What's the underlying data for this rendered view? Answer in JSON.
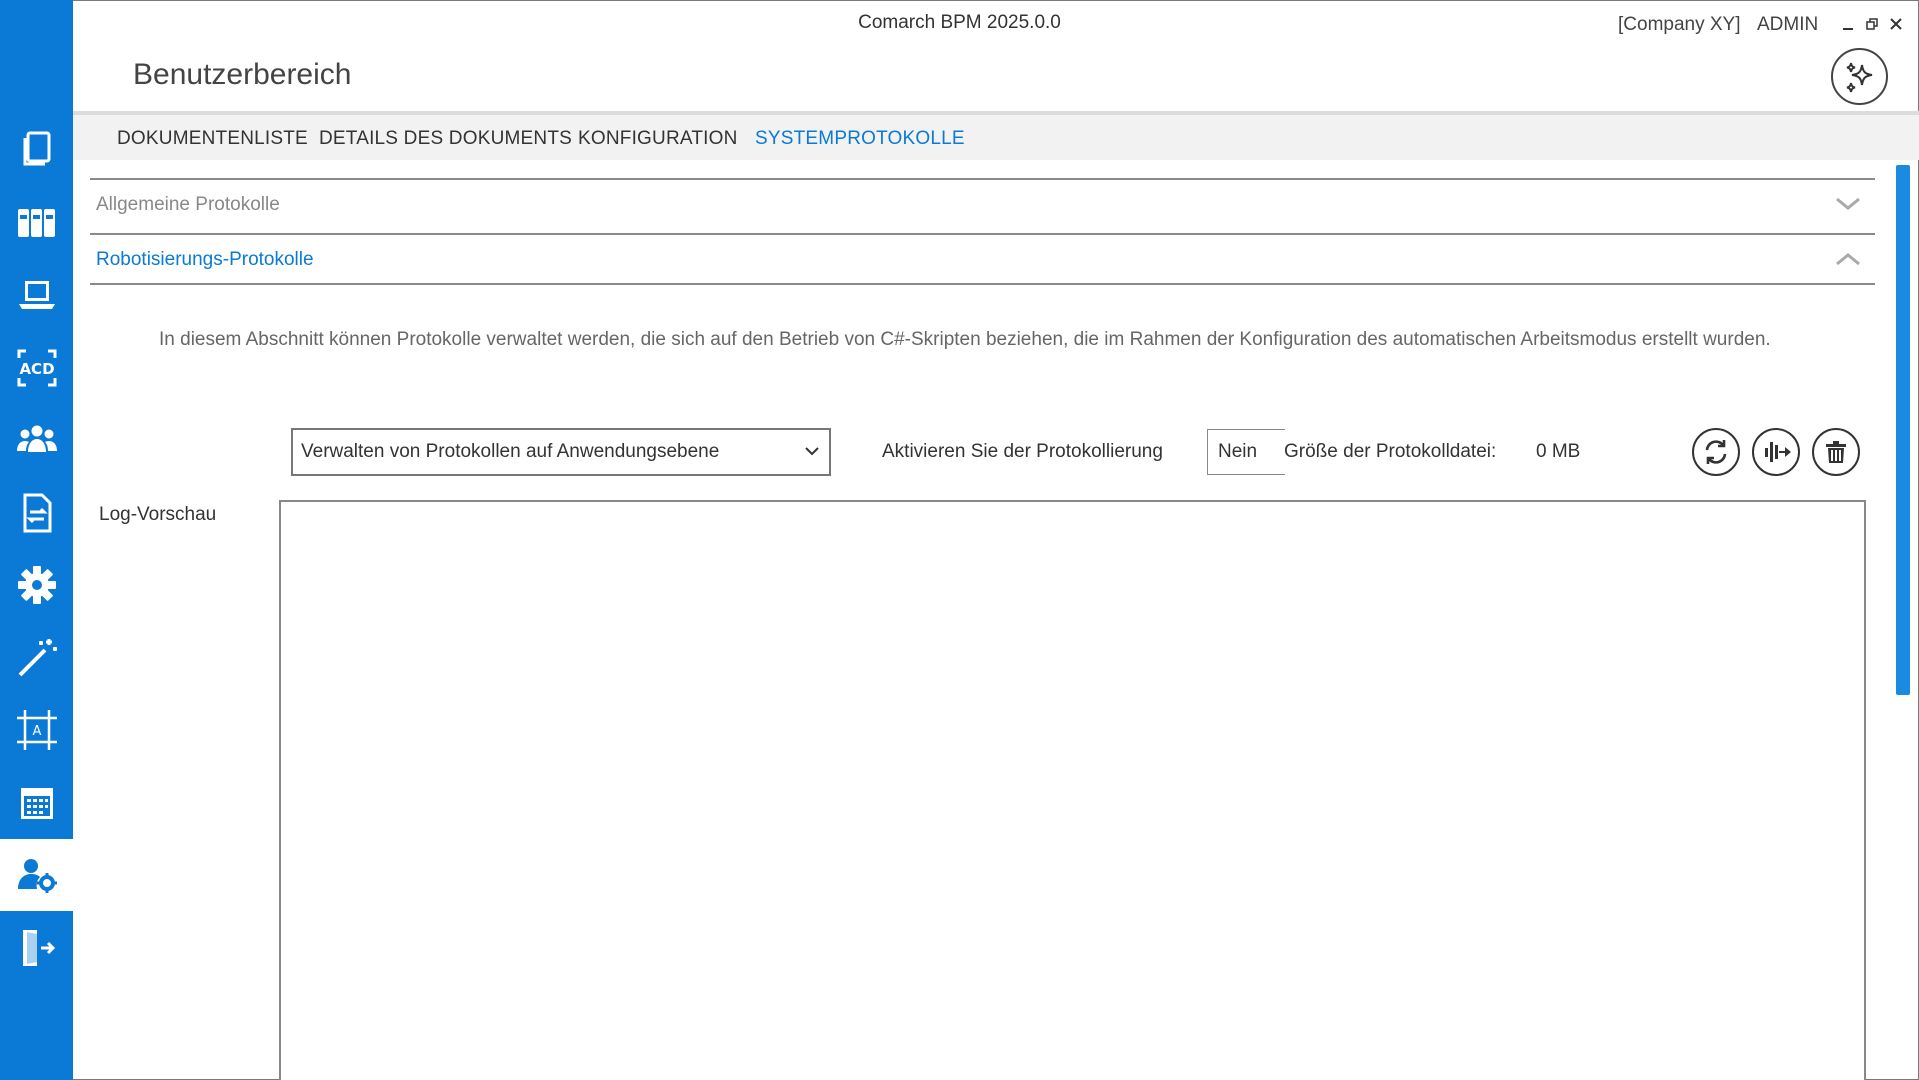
{
  "window": {
    "app_title": "Comarch BPM 2025.0.0",
    "company": "[Company XY]",
    "user": "ADMIN",
    "minimize_icon": "minimize-icon",
    "restore_icon": "restore-icon",
    "close_icon": "close-icon"
  },
  "header": {
    "page_title": "Benutzerbereich",
    "assistant_icon": "sparkles-icon"
  },
  "sidebar": {
    "accent": "#0a7ad6",
    "items": [
      {
        "icon": "documents-icon"
      },
      {
        "icon": "binders-icon"
      },
      {
        "icon": "laptop-icon"
      },
      {
        "icon": "acd-icon"
      },
      {
        "icon": "users-group-icon"
      },
      {
        "icon": "document-sync-icon"
      },
      {
        "icon": "gear-icon"
      },
      {
        "icon": "magic-wand-icon"
      },
      {
        "icon": "design-frame-icon"
      },
      {
        "icon": "calendar-icon"
      },
      {
        "icon": "user-settings-icon",
        "active": true
      },
      {
        "icon": "logout-door-icon"
      }
    ]
  },
  "tabs": [
    {
      "label": "DOKUMENTENLISTE"
    },
    {
      "label": "DETAILS DES DOKUMENTS"
    },
    {
      "label": "KONFIGURATION"
    },
    {
      "label": "SYSTEMPROTOKOLLE",
      "active": true
    }
  ],
  "accordion": {
    "general": {
      "label": "Allgemeine Protokolle",
      "expanded": false
    },
    "robot": {
      "label": "Robotisierungs-Protokolle",
      "expanded": true
    }
  },
  "robot_section": {
    "description": "In diesem Abschnitt können Protokolle verwaltet werden, die sich auf den Betrieb von C#-Skripten beziehen, die im Rahmen der Konfiguration des automatischen Arbeitsmodus erstellt wurden.",
    "select_value": "Verwalten von Protokollen auf Anwendungsebene",
    "enable_label": "Aktivieren Sie der Protokollierung",
    "enable_value": "Nein",
    "size_label": "Größe der Protokolldatei:",
    "size_value": "0 MB",
    "preview_label": "Log-Vorschau",
    "refresh_icon": "refresh-icon",
    "export_icon": "log-export-icon",
    "delete_icon": "trash-icon",
    "preview_content": ""
  }
}
